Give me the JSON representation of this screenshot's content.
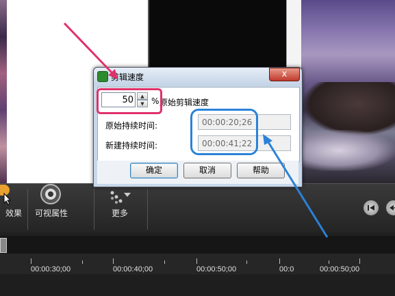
{
  "dialog": {
    "title": "剪辑速度",
    "close_label": "x",
    "speed_value": "50",
    "percent_sign": "%",
    "speed_label": "原始剪辑速度",
    "original_duration_label": "原始持续时间:",
    "original_duration_value": "00:00:20;26",
    "new_duration_label": "新建持续时间:",
    "new_duration_value": "00:00:41;22",
    "ok_label": "确定",
    "cancel_label": "取消",
    "help_label": "帮助"
  },
  "toolbar": {
    "effects_label": "效果",
    "visual_properties_label": "可视属性",
    "more_label": "更多"
  },
  "timeline": {
    "time_labels": [
      "00:00:30;00",
      "00:00:40;00",
      "00:00:50;00",
      "00:0",
      "00:00:50;00"
    ]
  },
  "colors": {
    "annotation_pink": "#e0306a",
    "annotation_blue": "#2a82d8"
  }
}
